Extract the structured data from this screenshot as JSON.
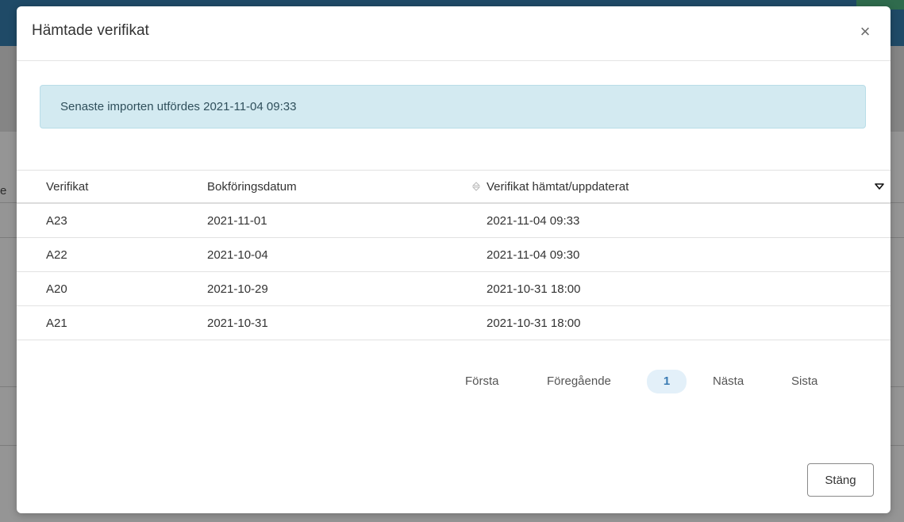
{
  "background": {
    "column_letter": "e"
  },
  "modal": {
    "title": "Hämtade verifikat",
    "close_icon_glyph": "×",
    "alert": {
      "text": "Senaste importen utfördes 2021-11-04 09:33"
    },
    "table": {
      "headers": [
        "Verifikat",
        "Bokföringsdatum",
        "Verifikat hämtat/uppdaterat"
      ],
      "sort": {
        "column": "Verifikat hämtat/uppdaterat",
        "direction": "descending"
      },
      "rows": [
        [
          "A23",
          "2021-11-01",
          "2021-11-04 09:33"
        ],
        [
          "A22",
          "2021-10-04",
          "2021-11-04 09:30"
        ],
        [
          "A20",
          "2021-10-29",
          "2021-10-31 18:00"
        ],
        [
          "A21",
          "2021-10-31",
          "2021-10-31 18:00"
        ]
      ]
    },
    "pagination": {
      "first": "Första",
      "previous": "Föregående",
      "current": "1",
      "next": "Nästa",
      "last": "Sista"
    },
    "footer": {
      "close_label": "Stäng"
    }
  },
  "colors": {
    "alert_bg": "#d3eaf1",
    "pagination_active_bg": "#e3f0f9",
    "pagination_active_text": "#3a7bb3",
    "topbar": "#1f4a67"
  }
}
